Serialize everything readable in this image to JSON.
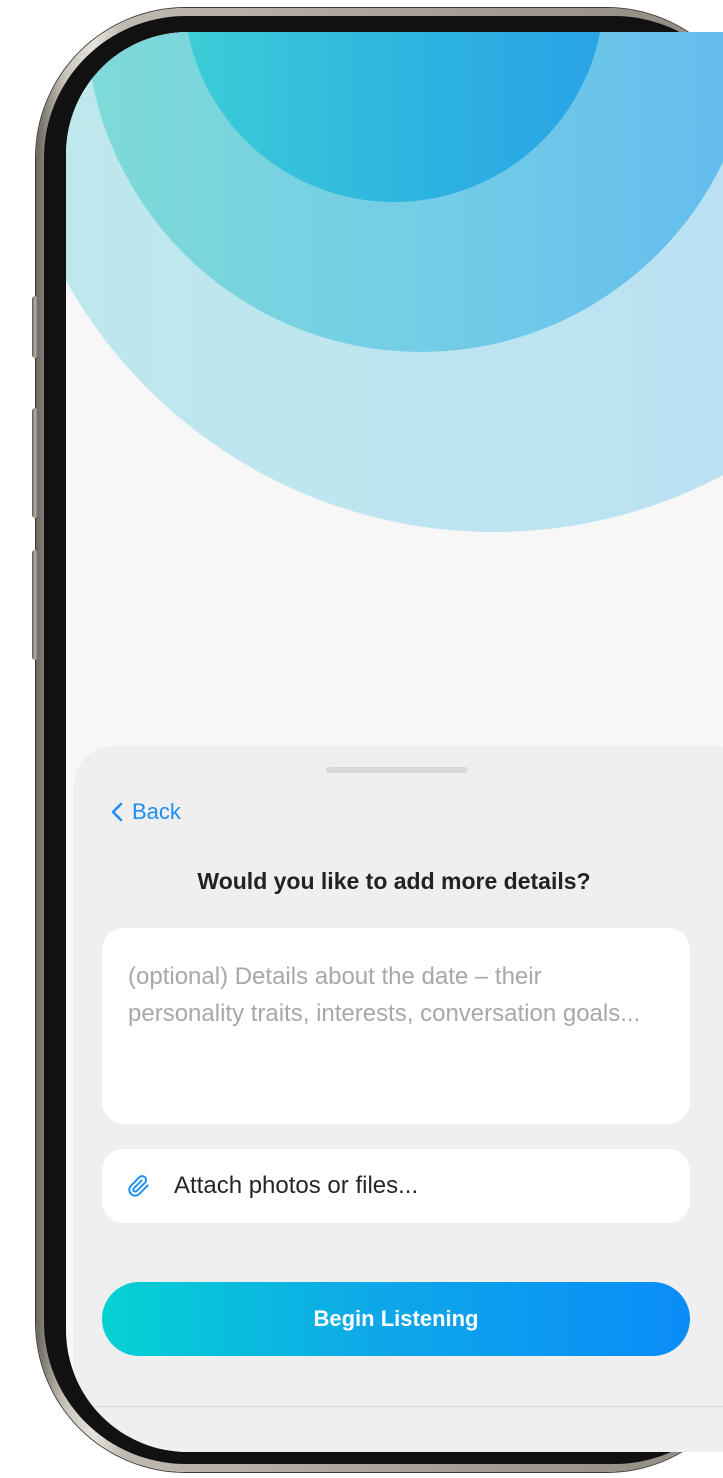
{
  "sheet": {
    "back_label": "Back",
    "title": "Would you like to add more details?",
    "details_placeholder": "(optional) Details about the date – their personality traits, interests, conversation goals...",
    "details_value": "",
    "attach_label": "Attach photos or files...",
    "primary_button_label": "Begin Listening"
  },
  "icons": {
    "back": "chevron-left-icon",
    "attach": "paperclip-icon"
  },
  "colors": {
    "accent": "#1d8ff2",
    "button_gradient_start": "#05d1d3",
    "button_gradient_end": "#0a8cf8",
    "sheet_background": "#efeff0",
    "screen_background": "#f7f7f8",
    "circle_outer": "#bde4f1",
    "circle_middle": "#72cce7",
    "circle_inner": "#2db4e0"
  }
}
